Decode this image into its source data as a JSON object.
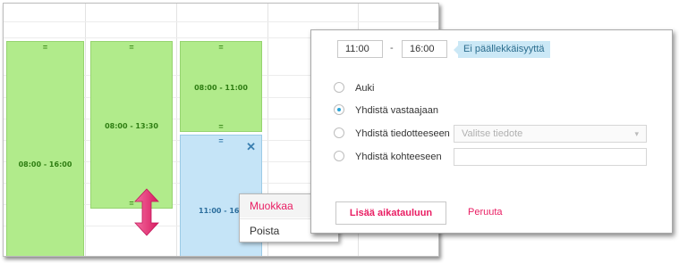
{
  "calendar": {
    "events": [
      {
        "time": "08:00 - 16:00",
        "handle": "="
      },
      {
        "time": "08:00 - 13:30",
        "handle": "="
      },
      {
        "time": "08:00 - 11:00",
        "handle": "="
      },
      {
        "time": "11:00 - 16:0",
        "handle": "="
      }
    ],
    "close_glyph": "✕"
  },
  "context_menu": {
    "items": [
      "Muokkaa",
      "Poista"
    ]
  },
  "dialog": {
    "start_time": "11:00",
    "separator": "-",
    "end_time": "16:00",
    "overlap_tag": "Ei päällekkäisyyttä",
    "options": [
      {
        "label": "Auki",
        "checked": false
      },
      {
        "label": "Yhdistä vastaajaan",
        "checked": true
      },
      {
        "label": "Yhdistä tiedotteeseen",
        "checked": false
      },
      {
        "label": "Yhdistä kohteeseen",
        "checked": false
      }
    ],
    "select_placeholder": "Valitse tiedote",
    "submit_label": "Lisää aikatauluun",
    "cancel_label": "Peruuta"
  },
  "colors": {
    "event_green": "#b1eb8b",
    "event_blue": "#c5e4f7",
    "accent_pink": "#e91e63",
    "radio_blue": "#29a3d6",
    "tag_blue": "#cbe8f6"
  }
}
